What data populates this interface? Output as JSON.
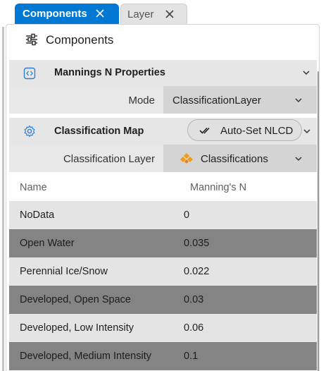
{
  "tabs": [
    {
      "label": "Components",
      "active": true
    },
    {
      "label": "Layer",
      "active": false
    }
  ],
  "panel": {
    "title": "Components",
    "icon": "sliders-icon"
  },
  "mannings": {
    "title": "Mannings N Properties",
    "icon": "code-brackets-icon",
    "mode_label": "Mode",
    "mode_value": "ClassificationLayer"
  },
  "classification": {
    "title": "Classification Map",
    "icon": "gear-icon",
    "autoset_label": "Auto-Set NLCD",
    "layer_label": "Classification Layer",
    "layer_value": "Classifications",
    "layer_icon_color": "#f39c12"
  },
  "table": {
    "headers": [
      "Name",
      "Manning's N"
    ],
    "rows": [
      {
        "name": "NoData",
        "value": "0"
      },
      {
        "name": "Open Water",
        "value": "0.035"
      },
      {
        "name": "Perennial Ice/Snow",
        "value": "0.022"
      },
      {
        "name": "Developed, Open Space",
        "value": "0.03"
      },
      {
        "name": "Developed, Low Intensity",
        "value": "0.06"
      },
      {
        "name": "Developed, Medium Intensity",
        "value": "0.1"
      }
    ]
  },
  "colors": {
    "accent": "#0078d4",
    "row_light": "#e4e4e4",
    "row_dark": "#848484"
  }
}
